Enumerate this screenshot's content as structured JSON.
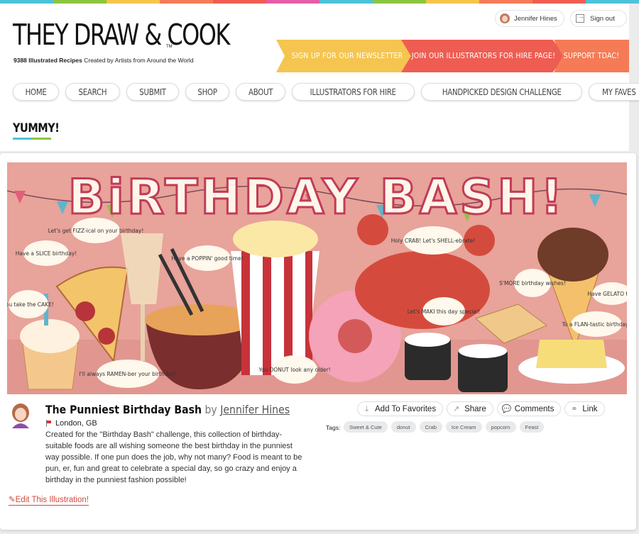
{
  "colors": {
    "strip": [
      "#4ec3d8",
      "#8cc63f",
      "#f5c54f",
      "#f57b57",
      "#ef5d52",
      "#e35da7",
      "#4ec3d8",
      "#8cc63f",
      "#f5c54f",
      "#f57b57",
      "#ef5d52",
      "#4ec3d8"
    ],
    "accent_red": "#d0483d",
    "underline": [
      "#4ec3d8",
      "#8cc63f"
    ]
  },
  "header": {
    "logo": "THEY DRAW & COOK",
    "logo_tm": "TM",
    "tagline_bold": "9388 Illustrated Recipes",
    "tagline_rest": " Created by Artists from Around the World",
    "user_name": "Jennifer Hines",
    "signout_label": "Sign out",
    "banners": [
      "SIGN UP FOR OUR NEWSLETTER",
      "JOIN OUR ILLUSTRATORS FOR HIRE PAGE!",
      "SUPPORT TDAC!"
    ]
  },
  "nav": [
    "HOME",
    "SEARCH",
    "SUBMIT",
    "SHOP",
    "ABOUT",
    "ILLUSTRATORS FOR HIRE",
    "HANDPICKED DESIGN CHALLENGE",
    "MY FAVES"
  ],
  "section": {
    "title": "YUMMY!"
  },
  "illustration": {
    "art_title": "BiRTHDAY BASH!",
    "speech": [
      "Have a SLICE birthday!",
      "Let's get FIZZ-ical on your birthday!",
      "Have a POPPIN' good time!",
      "Holy CRAB! Let's SHELL-ebrate!",
      "S'MORE birthday wishes!",
      "Have GELATO fun!",
      "You take the CAKE!",
      "Let's MAKI this day special!",
      "To a FLAN-tastic birthday!",
      "I'll always RAMEN-ber your birthday!",
      "You DONUT look any older!"
    ],
    "title": "The Punniest Birthday Bash",
    "by": " by ",
    "author": "Jennifer Hines",
    "location": "London, GB",
    "description": "Created for the \"Birthday Bash\" challenge, this collection of birthday-suitable foods are all wishing someone the best birthday in the punniest way possible. If one pun does the job, why not many? Food is meant to be pun, er, fun and great to celebrate a special day, so go crazy and enjoy a birthday in the punniest fashion possible!",
    "edit_label": "Edit This Illustration!"
  },
  "actions": [
    {
      "label": "Add To Favorites",
      "icon": "add-favorite-icon"
    },
    {
      "label": "Share",
      "icon": "share-icon"
    },
    {
      "label": "Comments",
      "icon": "comments-icon"
    },
    {
      "label": "Link",
      "icon": "link-icon"
    }
  ],
  "tags_label": "Tags:",
  "tags": [
    "Sweet & Cute",
    "donut",
    "Crab",
    "Ice Cream",
    "popcorn",
    "Feast"
  ]
}
